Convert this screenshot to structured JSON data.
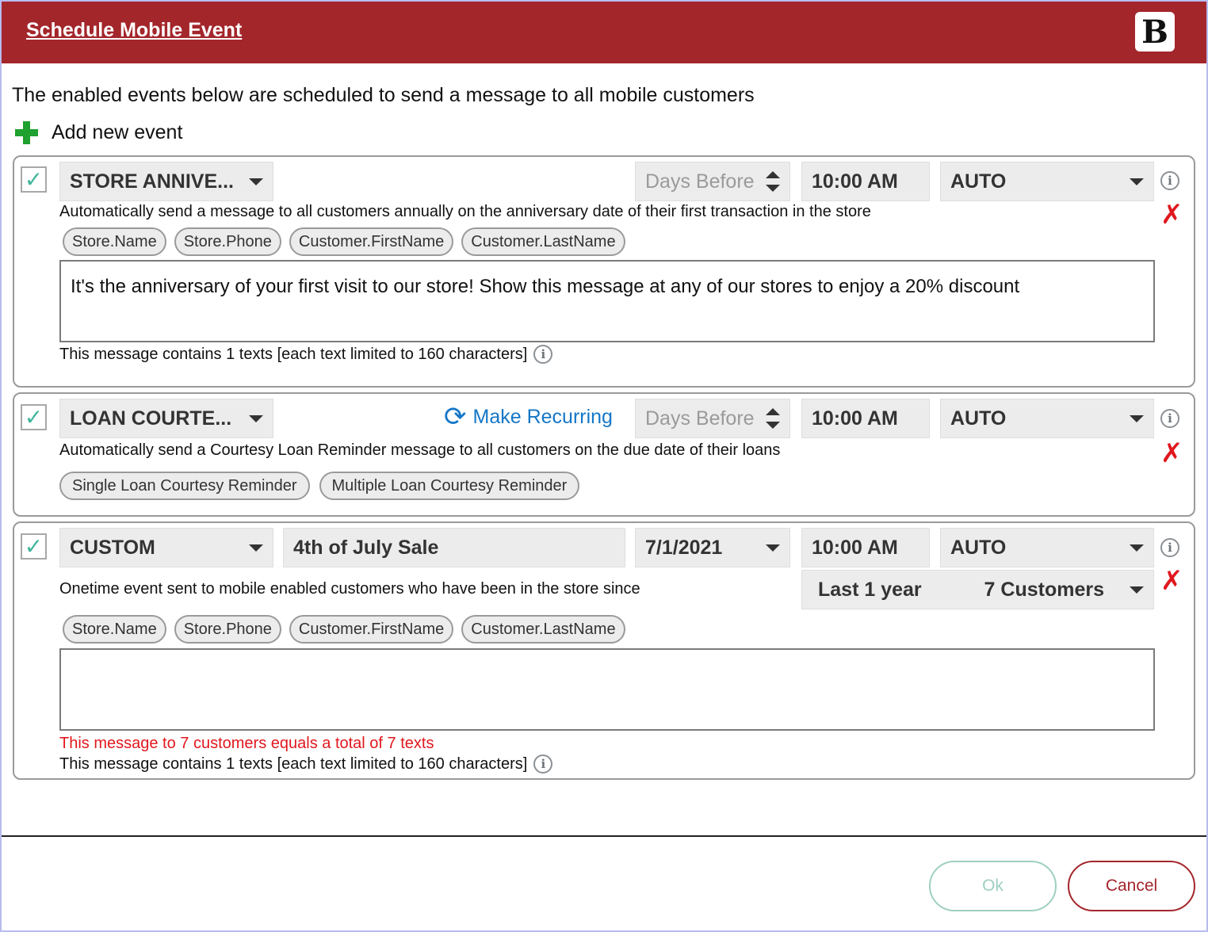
{
  "window": {
    "title": "Schedule Mobile Event",
    "logo_text": "B"
  },
  "intro": "The enabled events below are scheduled to send a message to all mobile customers",
  "add_event": {
    "label": "Add new event",
    "icon": "plus-icon"
  },
  "events": [
    {
      "checked": "✓",
      "type": "STORE ANNIVE...",
      "offset_placeholder": "Days Before",
      "time": "10:00 AM",
      "mode": "AUTO",
      "description": "Automatically send a message to all customers annually on the anniversary date of their first transaction in the store",
      "chips": [
        "Store.Name",
        "Store.Phone",
        "Customer.FirstName",
        "Customer.LastName"
      ],
      "message": "It's the anniversary of your first visit to our store!  Show this message at any of our stores to enjoy a 20% discount",
      "count_text": "This message contains 1 texts [each text limited to 160 characters]"
    },
    {
      "checked": "✓",
      "type": "LOAN COURTE...",
      "recurring_label": "Make Recurring",
      "offset_placeholder": "Days Before",
      "time": "10:00 AM",
      "mode": "AUTO",
      "description": "Automatically send a Courtesy Loan Reminder message to all customers on the due date of their loans",
      "chips": [
        "Single Loan Courtesy Reminder",
        "Multiple Loan Courtesy Reminder"
      ]
    },
    {
      "checked": "✓",
      "type": "CUSTOM",
      "name": "4th of July Sale",
      "date": "7/1/2021",
      "time": "10:00 AM",
      "mode": "AUTO",
      "audience_period": "Last 1 year",
      "audience_count": "7 Customers",
      "description": "Onetime event sent to mobile enabled customers who have been in the store since",
      "chips": [
        "Store.Name",
        "Store.Phone",
        "Customer.FirstName",
        "Customer.LastName"
      ],
      "message": "",
      "warning": "This message to 7 customers equals a total of 7 texts",
      "count_text": "This message contains 1 texts [each text limited to 160 characters]"
    }
  ],
  "icons": {
    "info": "i",
    "delete": "✗",
    "refresh": "⟳"
  },
  "buttons": {
    "ok": "Ok",
    "cancel": "Cancel"
  },
  "colors": {
    "titlebar": "#a3262b",
    "accent_check": "#41b69b",
    "link": "#1577c7",
    "danger": "#e0181e"
  }
}
